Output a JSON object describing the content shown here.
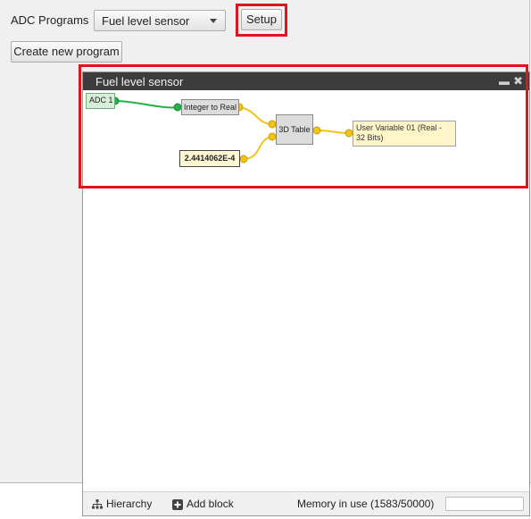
{
  "toolbar": {
    "programs_label": "ADC Programs",
    "selected_program": "Fuel level sensor",
    "setup_label": "Setup",
    "create_label": "Create new program"
  },
  "window": {
    "title": "Fuel level sensor",
    "minimize_glyph": "▬",
    "close_glyph": "✖"
  },
  "blocks": {
    "adc": "ADC 1",
    "int_to_real": "Integer to Real",
    "table": "3D Table",
    "constant": "2.4414062E-4",
    "user_var": "User Variable 01 (Real - 32 Bits)"
  },
  "status": {
    "hierarchy": "Hierarchy",
    "add_block": "Add block",
    "memory": "Memory in use (1583/50000)"
  },
  "colors": {
    "highlight": "#e0141e",
    "wire_green": "#22b04a",
    "wire_yellow": "#f0c419",
    "title_bar": "#3c3c3c"
  }
}
